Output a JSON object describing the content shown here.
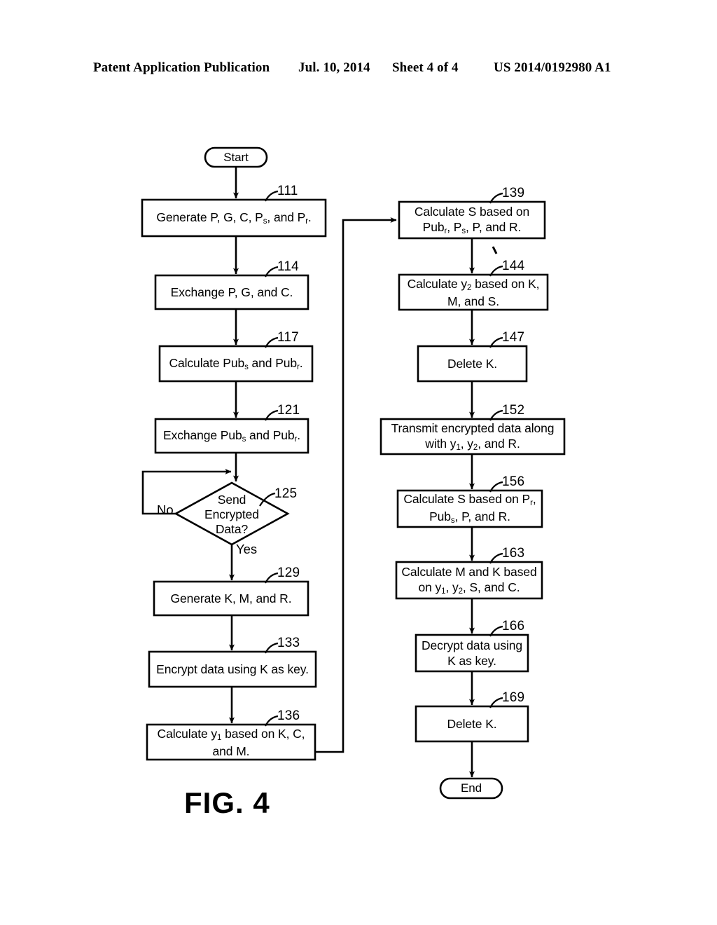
{
  "header": {
    "publication": "Patent Application Publication",
    "date": "Jul. 10, 2014",
    "sheet": "Sheet 4 of 4",
    "patent_number": "US 2014/0192980 A1"
  },
  "figure": {
    "label": "FIG. 4",
    "terminals": {
      "start": "Start",
      "end": "End"
    },
    "branch_labels": {
      "no": "No",
      "yes": "Yes"
    },
    "nodes": [
      {
        "ref": "111",
        "text": "Generate P, G, C, Pₛ, and Pᵣ."
      },
      {
        "ref": "114",
        "text": "Exchange P, G, and C."
      },
      {
        "ref": "117",
        "text": "Calculate Pubₛ and Pubᵣ."
      },
      {
        "ref": "121",
        "text": "Exchange Pubₛ and Pubᵣ."
      },
      {
        "ref": "125",
        "text": "Send Encrypted Data?"
      },
      {
        "ref": "129",
        "text": "Generate K, M, and R."
      },
      {
        "ref": "133",
        "text": "Encrypt data using K as key."
      },
      {
        "ref": "136",
        "text": "Calculate y₁ based on K, C, and M."
      },
      {
        "ref": "139",
        "text": "Calculate S based on Pubᵣ, Pₛ, P, and R."
      },
      {
        "ref": "144",
        "text": "Calculate y₂ based on K, M, and S."
      },
      {
        "ref": "147",
        "text": "Delete K."
      },
      {
        "ref": "152",
        "text": "Transmit encrypted data along with y₁, y₂, and R."
      },
      {
        "ref": "156",
        "text": "Calculate S based on Pᵣ, Pubₛ, P, and R."
      },
      {
        "ref": "163",
        "text": "Calculate M and K based on y₁, y₂, S, and C."
      },
      {
        "ref": "166",
        "text": "Decrypt data using K as key."
      },
      {
        "ref": "169",
        "text": "Delete K."
      }
    ],
    "refs": {
      "r111": "111",
      "r114": "114",
      "r117": "117",
      "r121": "121",
      "r125": "125",
      "r129": "129",
      "r133": "133",
      "r136": "136",
      "r139": "139",
      "r144": "144",
      "r147": "147",
      "r152": "152",
      "r156": "156",
      "r163": "163",
      "r166": "166",
      "r169": "169"
    },
    "box_lines": {
      "b111_l1": "Generate P, G, C, P",
      "b111_s1": "s",
      "b111_l2": ", and P",
      "b111_s2": "r",
      "b111_l3": ".",
      "b114": "Exchange P, G, and C.",
      "b117_l1": "Calculate Pub",
      "b117_s1": "s",
      "b117_l2": " and Pub",
      "b117_s2": "r",
      "b117_l3": ".",
      "b121_l1": "Exchange Pub",
      "b121_s1": "s",
      "b121_l2": " and Pub",
      "b121_s2": "r",
      "b121_l3": ".",
      "b125_l1": "Send",
      "b125_l2": "Encrypted",
      "b125_l3": "Data?",
      "b129": "Generate K, M, and R.",
      "b133": "Encrypt data using K as key.",
      "b136_l1": "Calculate y",
      "b136_s1": "1",
      "b136_l2": " based on K, C,",
      "b136_l3": "and M.",
      "b139_l1": "Calculate S based on",
      "b139_l2a": "Pub",
      "b139_s1": "r",
      "b139_l2b": ", P",
      "b139_s2": "s",
      "b139_l2c": ", P, and R.",
      "b144_l1a": "Calculate y",
      "b144_s1": "2",
      "b144_l1b": " based on K,",
      "b144_l2": "M, and S.",
      "b147": "Delete K.",
      "b152_l1": "Transmit encrypted data along",
      "b152_l2a": "with y",
      "b152_s1": "1",
      "b152_l2b": ", y",
      "b152_s2": "2",
      "b152_l2c": ", and R.",
      "b156_l1a": "Calculate S based on P",
      "b156_s1": "r",
      "b156_l1b": ",",
      "b156_l2a": "Pub",
      "b156_s2": "s",
      "b156_l2b": ", P, and R.",
      "b163_l1": "Calculate M and K based",
      "b163_l2a": "on y",
      "b163_s1": "1",
      "b163_l2b": ", y",
      "b163_s2": "2",
      "b163_l2c": ", S, and C.",
      "b166_l1": "Decrypt data using",
      "b166_l2": "K as key.",
      "b169": "Delete K."
    }
  },
  "colors": {
    "ink": "#000000",
    "paper": "#ffffff"
  }
}
